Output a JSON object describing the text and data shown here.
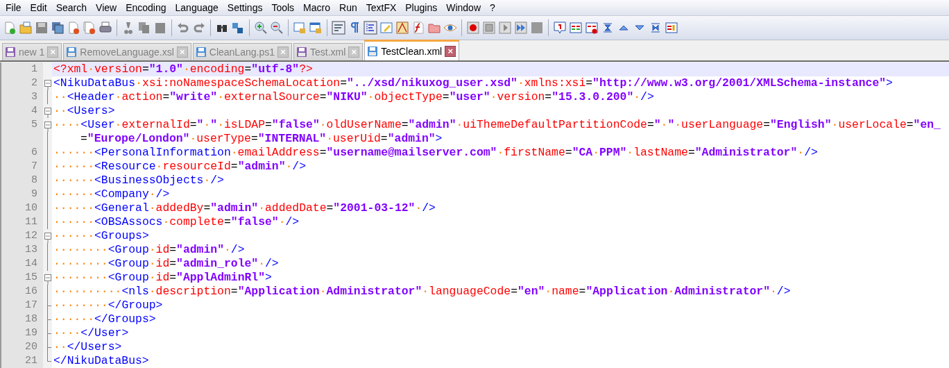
{
  "menu": [
    "File",
    "Edit",
    "Search",
    "View",
    "Encoding",
    "Language",
    "Settings",
    "Tools",
    "Macro",
    "Run",
    "TextFX",
    "Plugins",
    "Window",
    "?"
  ],
  "tabs": [
    {
      "label": "new 1",
      "selected": false,
      "color": "#8a5fb0"
    },
    {
      "label": "RemoveLanguage.xsl",
      "selected": false,
      "color": "#4a8fd8"
    },
    {
      "label": "CleanLang.ps1",
      "selected": false,
      "color": "#4a8fd8"
    },
    {
      "label": "Test.xml",
      "selected": false,
      "color": "#8a5fb0"
    },
    {
      "label": "TestClean.xml",
      "selected": true,
      "color": "#4a8fd8"
    }
  ],
  "close_mark": "×",
  "editor": {
    "lines": [
      {
        "number": "1",
        "current": true,
        "fold_start": false,
        "fold_end": false,
        "tokens": [
          {
            "kind": "pi",
            "text": "<?xml"
          },
          {
            "kind": "ws",
            "text": "·"
          },
          {
            "kind": "attr",
            "text": "version"
          },
          {
            "kind": "eq",
            "text": "="
          },
          {
            "kind": "val",
            "text": "\"1.0\""
          },
          {
            "kind": "ws",
            "text": "·"
          },
          {
            "kind": "attr",
            "text": "encoding"
          },
          {
            "kind": "eq",
            "text": "="
          },
          {
            "kind": "val",
            "text": "\"utf-8\""
          },
          {
            "kind": "pi",
            "text": "?>"
          }
        ]
      },
      {
        "number": "2",
        "current": false,
        "fold_start": true,
        "fold_end": false,
        "tokens": [
          {
            "kind": "tag",
            "text": "<NikuDataBus"
          },
          {
            "kind": "ws",
            "text": "·"
          },
          {
            "kind": "attr",
            "text": "xsi:noNamespaceSchemaLocation"
          },
          {
            "kind": "eq",
            "text": "="
          },
          {
            "kind": "val",
            "text": "\"../xsd/nikuxog_user.xsd\""
          },
          {
            "kind": "ws",
            "text": "·"
          },
          {
            "kind": "attr",
            "text": "xmlns:xsi"
          },
          {
            "kind": "eq",
            "text": "="
          },
          {
            "kind": "val",
            "text": "\"http://www.w3.org/2001/XMLSchema-instance\""
          },
          {
            "kind": "tag",
            "text": ">"
          }
        ]
      },
      {
        "number": "3",
        "current": false,
        "fold_start": false,
        "fold_end": false,
        "tokens": [
          {
            "kind": "ws",
            "text": "··"
          },
          {
            "kind": "tag",
            "text": "<Header"
          },
          {
            "kind": "ws",
            "text": "·"
          },
          {
            "kind": "attr",
            "text": "action"
          },
          {
            "kind": "eq",
            "text": "="
          },
          {
            "kind": "val",
            "text": "\"write\""
          },
          {
            "kind": "ws",
            "text": "·"
          },
          {
            "kind": "attr",
            "text": "externalSource"
          },
          {
            "kind": "eq",
            "text": "="
          },
          {
            "kind": "val",
            "text": "\"NIKU\""
          },
          {
            "kind": "ws",
            "text": "·"
          },
          {
            "kind": "attr",
            "text": "objectType"
          },
          {
            "kind": "eq",
            "text": "="
          },
          {
            "kind": "val",
            "text": "\"user\""
          },
          {
            "kind": "ws",
            "text": "·"
          },
          {
            "kind": "attr",
            "text": "version"
          },
          {
            "kind": "eq",
            "text": "="
          },
          {
            "kind": "val",
            "text": "\"15.3.0.200\""
          },
          {
            "kind": "ws",
            "text": "·"
          },
          {
            "kind": "tag",
            "text": "/>"
          }
        ]
      },
      {
        "number": "4",
        "current": false,
        "fold_start": true,
        "fold_end": false,
        "tokens": [
          {
            "kind": "ws",
            "text": "··"
          },
          {
            "kind": "tag",
            "text": "<Users>"
          }
        ]
      },
      {
        "number": "5",
        "current": false,
        "fold_start": true,
        "fold_end": false,
        "tokens": [
          {
            "kind": "ws",
            "text": "····"
          },
          {
            "kind": "tag",
            "text": "<User"
          },
          {
            "kind": "ws",
            "text": "·"
          },
          {
            "kind": "attr",
            "text": "externalId"
          },
          {
            "kind": "eq",
            "text": "="
          },
          {
            "kind": "val",
            "text": "\""
          },
          {
            "kind": "ws",
            "text": "·"
          },
          {
            "kind": "val",
            "text": "\""
          },
          {
            "kind": "ws",
            "text": "·"
          },
          {
            "kind": "attr",
            "text": "isLDAP"
          },
          {
            "kind": "eq",
            "text": "="
          },
          {
            "kind": "val",
            "text": "\"false\""
          },
          {
            "kind": "ws",
            "text": "·"
          },
          {
            "kind": "attr",
            "text": "oldUserName"
          },
          {
            "kind": "eq",
            "text": "="
          },
          {
            "kind": "val",
            "text": "\"admin\""
          },
          {
            "kind": "ws",
            "text": "·"
          },
          {
            "kind": "attr",
            "text": "uiThemeDefaultPartitionCode"
          },
          {
            "kind": "eq",
            "text": "="
          },
          {
            "kind": "val",
            "text": "\""
          },
          {
            "kind": "ws",
            "text": "·"
          },
          {
            "kind": "val",
            "text": "\""
          },
          {
            "kind": "ws",
            "text": "·"
          },
          {
            "kind": "attr",
            "text": "userLanguage"
          },
          {
            "kind": "eq",
            "text": "="
          },
          {
            "kind": "val",
            "text": "\"English\""
          },
          {
            "kind": "ws",
            "text": "·"
          },
          {
            "kind": "attr",
            "text": "userLocale"
          },
          {
            "kind": "eq",
            "text": "="
          },
          {
            "kind": "val",
            "text": "\"en_"
          }
        ],
        "continuation": [
          {
            "kind": "eq",
            "text": "="
          },
          {
            "kind": "val",
            "text": "\"Europe/London\""
          },
          {
            "kind": "ws",
            "text": "·"
          },
          {
            "kind": "attr",
            "text": "userType"
          },
          {
            "kind": "eq",
            "text": "="
          },
          {
            "kind": "val",
            "text": "\"INTERNAL\""
          },
          {
            "kind": "ws",
            "text": "·"
          },
          {
            "kind": "attr",
            "text": "userUid"
          },
          {
            "kind": "eq",
            "text": "="
          },
          {
            "kind": "val",
            "text": "\"admin\""
          },
          {
            "kind": "tag",
            "text": ">"
          }
        ]
      },
      {
        "number": "6",
        "current": false,
        "fold_start": false,
        "fold_end": false,
        "tokens": [
          {
            "kind": "ws",
            "text": "······"
          },
          {
            "kind": "tag",
            "text": "<PersonalInformation"
          },
          {
            "kind": "ws",
            "text": "·"
          },
          {
            "kind": "attr",
            "text": "emailAddress"
          },
          {
            "kind": "eq",
            "text": "="
          },
          {
            "kind": "val",
            "text": "\"username@mailserver.com\""
          },
          {
            "kind": "ws",
            "text": "·"
          },
          {
            "kind": "attr",
            "text": "firstName"
          },
          {
            "kind": "eq",
            "text": "="
          },
          {
            "kind": "val",
            "text": "\"CA"
          },
          {
            "kind": "ws",
            "text": "·"
          },
          {
            "kind": "val",
            "text": "PPM\""
          },
          {
            "kind": "ws",
            "text": "·"
          },
          {
            "kind": "attr",
            "text": "lastName"
          },
          {
            "kind": "eq",
            "text": "="
          },
          {
            "kind": "val",
            "text": "\"Administrator\""
          },
          {
            "kind": "ws",
            "text": "·"
          },
          {
            "kind": "tag",
            "text": "/>"
          }
        ]
      },
      {
        "number": "7",
        "current": false,
        "fold_start": false,
        "fold_end": false,
        "tokens": [
          {
            "kind": "ws",
            "text": "······"
          },
          {
            "kind": "tag",
            "text": "<Resource"
          },
          {
            "kind": "ws",
            "text": "·"
          },
          {
            "kind": "attr",
            "text": "resourceId"
          },
          {
            "kind": "eq",
            "text": "="
          },
          {
            "kind": "val",
            "text": "\"admin\""
          },
          {
            "kind": "ws",
            "text": "·"
          },
          {
            "kind": "tag",
            "text": "/>"
          }
        ]
      },
      {
        "number": "8",
        "current": false,
        "fold_start": false,
        "fold_end": false,
        "tokens": [
          {
            "kind": "ws",
            "text": "······"
          },
          {
            "kind": "tag",
            "text": "<BusinessObjects"
          },
          {
            "kind": "ws",
            "text": "·"
          },
          {
            "kind": "tag",
            "text": "/>"
          }
        ]
      },
      {
        "number": "9",
        "current": false,
        "fold_start": false,
        "fold_end": false,
        "tokens": [
          {
            "kind": "ws",
            "text": "······"
          },
          {
            "kind": "tag",
            "text": "<Company"
          },
          {
            "kind": "ws",
            "text": "·"
          },
          {
            "kind": "tag",
            "text": "/>"
          }
        ]
      },
      {
        "number": "10",
        "current": false,
        "fold_start": false,
        "fold_end": false,
        "tokens": [
          {
            "kind": "ws",
            "text": "······"
          },
          {
            "kind": "tag",
            "text": "<General"
          },
          {
            "kind": "ws",
            "text": "·"
          },
          {
            "kind": "attr",
            "text": "addedBy"
          },
          {
            "kind": "eq",
            "text": "="
          },
          {
            "kind": "val",
            "text": "\"admin\""
          },
          {
            "kind": "ws",
            "text": "·"
          },
          {
            "kind": "attr",
            "text": "addedDate"
          },
          {
            "kind": "eq",
            "text": "="
          },
          {
            "kind": "val",
            "text": "\"2001-03-12\""
          },
          {
            "kind": "ws",
            "text": "·"
          },
          {
            "kind": "tag",
            "text": "/>"
          }
        ]
      },
      {
        "number": "11",
        "current": false,
        "fold_start": false,
        "fold_end": false,
        "tokens": [
          {
            "kind": "ws",
            "text": "······"
          },
          {
            "kind": "tag",
            "text": "<OBSAssocs"
          },
          {
            "kind": "ws",
            "text": "·"
          },
          {
            "kind": "attr",
            "text": "complete"
          },
          {
            "kind": "eq",
            "text": "="
          },
          {
            "kind": "val",
            "text": "\"false\""
          },
          {
            "kind": "ws",
            "text": "·"
          },
          {
            "kind": "tag",
            "text": "/>"
          }
        ]
      },
      {
        "number": "12",
        "current": false,
        "fold_start": true,
        "fold_end": false,
        "tokens": [
          {
            "kind": "ws",
            "text": "······"
          },
          {
            "kind": "tag",
            "text": "<Groups>"
          }
        ]
      },
      {
        "number": "13",
        "current": false,
        "fold_start": false,
        "fold_end": false,
        "tokens": [
          {
            "kind": "ws",
            "text": "········"
          },
          {
            "kind": "tag",
            "text": "<Group"
          },
          {
            "kind": "ws",
            "text": "·"
          },
          {
            "kind": "attr",
            "text": "id"
          },
          {
            "kind": "eq",
            "text": "="
          },
          {
            "kind": "val",
            "text": "\"admin\""
          },
          {
            "kind": "ws",
            "text": "·"
          },
          {
            "kind": "tag",
            "text": "/>"
          }
        ]
      },
      {
        "number": "14",
        "current": false,
        "fold_start": false,
        "fold_end": false,
        "tokens": [
          {
            "kind": "ws",
            "text": "········"
          },
          {
            "kind": "tag",
            "text": "<Group"
          },
          {
            "kind": "ws",
            "text": "·"
          },
          {
            "kind": "attr",
            "text": "id"
          },
          {
            "kind": "eq",
            "text": "="
          },
          {
            "kind": "val",
            "text": "\"admin_role\""
          },
          {
            "kind": "ws",
            "text": "·"
          },
          {
            "kind": "tag",
            "text": "/>"
          }
        ]
      },
      {
        "number": "15",
        "current": false,
        "fold_start": true,
        "fold_end": false,
        "tokens": [
          {
            "kind": "ws",
            "text": "········"
          },
          {
            "kind": "tag",
            "text": "<Group"
          },
          {
            "kind": "ws",
            "text": "·"
          },
          {
            "kind": "attr",
            "text": "id"
          },
          {
            "kind": "eq",
            "text": "="
          },
          {
            "kind": "val",
            "text": "\"ApplAdminRl\""
          },
          {
            "kind": "tag",
            "text": ">"
          }
        ]
      },
      {
        "number": "16",
        "current": false,
        "fold_start": false,
        "fold_end": false,
        "tokens": [
          {
            "kind": "ws",
            "text": "··········"
          },
          {
            "kind": "tag",
            "text": "<nls"
          },
          {
            "kind": "ws",
            "text": "·"
          },
          {
            "kind": "attr",
            "text": "description"
          },
          {
            "kind": "eq",
            "text": "="
          },
          {
            "kind": "val",
            "text": "\"Application"
          },
          {
            "kind": "ws",
            "text": "·"
          },
          {
            "kind": "val",
            "text": "Administrator\""
          },
          {
            "kind": "ws",
            "text": "·"
          },
          {
            "kind": "attr",
            "text": "languageCode"
          },
          {
            "kind": "eq",
            "text": "="
          },
          {
            "kind": "val",
            "text": "\"en\""
          },
          {
            "kind": "ws",
            "text": "·"
          },
          {
            "kind": "attr",
            "text": "name"
          },
          {
            "kind": "eq",
            "text": "="
          },
          {
            "kind": "val",
            "text": "\"Application"
          },
          {
            "kind": "ws",
            "text": "·"
          },
          {
            "kind": "val",
            "text": "Administrator\""
          },
          {
            "kind": "ws",
            "text": "·"
          },
          {
            "kind": "tag",
            "text": "/>"
          }
        ]
      },
      {
        "number": "17",
        "current": false,
        "fold_start": false,
        "fold_end": true,
        "tokens": [
          {
            "kind": "ws",
            "text": "········"
          },
          {
            "kind": "tag",
            "text": "</Group>"
          }
        ]
      },
      {
        "number": "18",
        "current": false,
        "fold_start": false,
        "fold_end": true,
        "tokens": [
          {
            "kind": "ws",
            "text": "······"
          },
          {
            "kind": "tag",
            "text": "</Groups>"
          }
        ]
      },
      {
        "number": "19",
        "current": false,
        "fold_start": false,
        "fold_end": true,
        "tokens": [
          {
            "kind": "ws",
            "text": "····"
          },
          {
            "kind": "tag",
            "text": "</User>"
          }
        ]
      },
      {
        "number": "20",
        "current": false,
        "fold_start": false,
        "fold_end": true,
        "tokens": [
          {
            "kind": "ws",
            "text": "··"
          },
          {
            "kind": "tag",
            "text": "</Users>"
          }
        ]
      },
      {
        "number": "21",
        "current": false,
        "fold_start": false,
        "fold_end": true,
        "tokens": [
          {
            "kind": "tag",
            "text": "</NikuDataBus>"
          }
        ]
      }
    ]
  }
}
